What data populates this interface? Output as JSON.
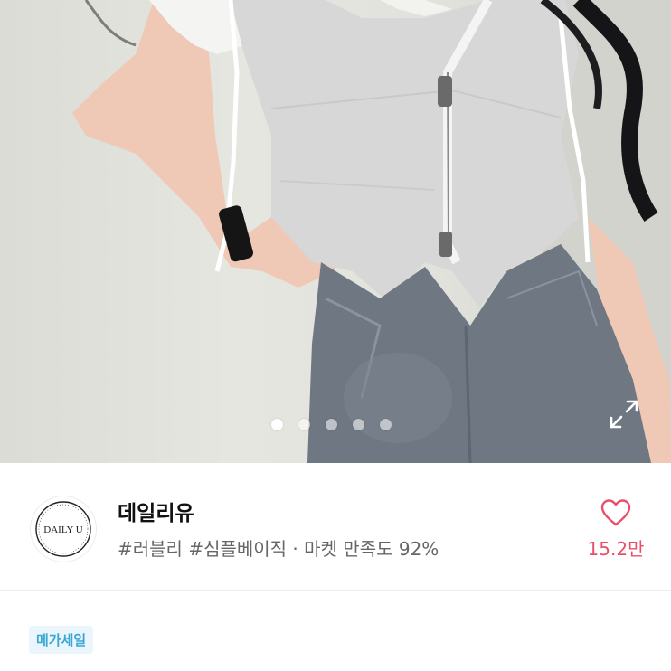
{
  "gallery": {
    "image_alt": "Model wearing grey cropped hooded zip-up vest with jeans",
    "slide_count": 5,
    "active_index": 0,
    "expand_icon": "expand-icon"
  },
  "shop": {
    "logo_text": "DAILY U",
    "name": "데일리유",
    "tags": "#러블리 #심플베이직 · 마켓 만족도 92%",
    "like_count": "15.2만",
    "like_icon": "heart-outline-icon",
    "accent_color": "#e8506a"
  },
  "badge": {
    "label": "메가세일",
    "text_color": "#3aa6d6",
    "bg_color": "#eaf6fb"
  }
}
